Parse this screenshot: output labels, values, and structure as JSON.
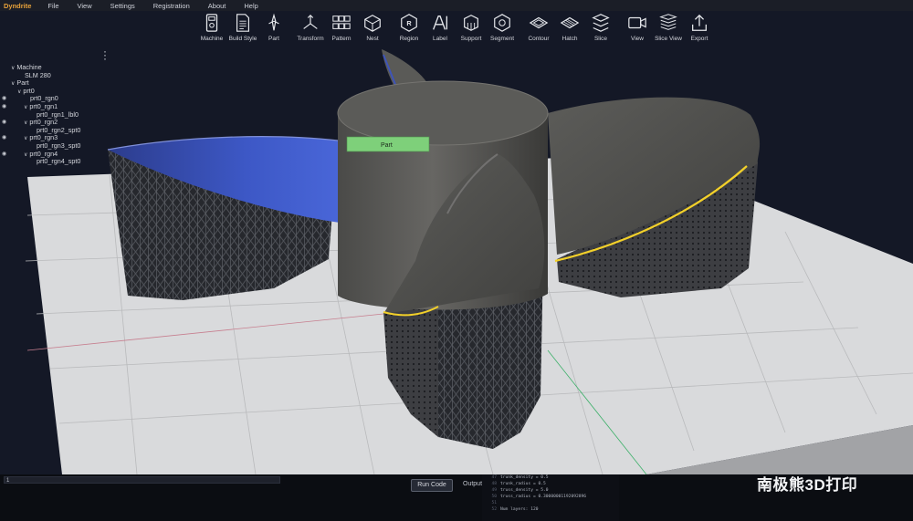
{
  "app": {
    "name": "Dyndrite"
  },
  "menu": [
    "File",
    "View",
    "Settings",
    "Registration",
    "About",
    "Help"
  ],
  "toolbar": [
    {
      "label": "Machine",
      "icon": "machine-icon"
    },
    {
      "label": "Build Style",
      "icon": "build-style-icon"
    },
    {
      "label": "Part",
      "icon": "part-icon"
    },
    {
      "label": "Transform",
      "icon": "transform-icon"
    },
    {
      "label": "Pattern",
      "icon": "pattern-icon"
    },
    {
      "label": "Nest",
      "icon": "nest-icon"
    },
    {
      "label": "Region",
      "icon": "region-icon"
    },
    {
      "label": "Label",
      "icon": "label-icon"
    },
    {
      "label": "Support",
      "icon": "support-icon"
    },
    {
      "label": "Segment",
      "icon": "segment-icon"
    },
    {
      "label": "Contour",
      "icon": "contour-icon"
    },
    {
      "label": "Hatch",
      "icon": "hatch-icon"
    },
    {
      "label": "Slice",
      "icon": "slice-icon"
    },
    {
      "label": "View",
      "icon": "camera-icon"
    },
    {
      "label": "Slice View",
      "icon": "slice-view-icon"
    },
    {
      "label": "Export",
      "icon": "export-icon"
    }
  ],
  "tree": [
    {
      "label": "Machine",
      "eye": false,
      "caret": true
    },
    {
      "label": "SLM 280",
      "eye": false,
      "caret": false
    },
    {
      "label": "Part",
      "eye": false,
      "caret": true
    },
    {
      "label": "prt0",
      "eye": false,
      "caret": true
    },
    {
      "label": "prt0_rgn0",
      "eye": true,
      "caret": false
    },
    {
      "label": "prt0_rgn1",
      "eye": true,
      "caret": true
    },
    {
      "label": "prt0_rgn1_lbl0",
      "eye": false,
      "caret": false
    },
    {
      "label": "prt0_rgn2",
      "eye": true,
      "caret": true
    },
    {
      "label": "prt0_rgn2_spt0",
      "eye": false,
      "caret": false
    },
    {
      "label": "prt0_rgn3",
      "eye": true,
      "caret": true
    },
    {
      "label": "prt0_rgn3_spt0",
      "eye": false,
      "caret": false
    },
    {
      "label": "prt0_rgn4",
      "eye": true,
      "caret": true
    },
    {
      "label": "prt0_rgn4_spt0",
      "eye": false,
      "caret": false
    }
  ],
  "viewport": {
    "part_label": "Part"
  },
  "console": {
    "prompt": "1"
  },
  "run_button": "Run Code",
  "output_label": "Output",
  "output_lines": [
    {
      "n": "47",
      "text": "trunk_density = 0.5"
    },
    {
      "n": "48",
      "text": "trunk_radius = 0.5"
    },
    {
      "n": "49",
      "text": "truss_density = 5.0"
    },
    {
      "n": "50",
      "text": "truss_radius = 0.30000001192092896"
    },
    {
      "n": "51",
      "text": ""
    },
    {
      "n": "52",
      "text": "Num layers:  120"
    }
  ],
  "watermark": "南极熊3D打印",
  "colors": {
    "accent": "#e8a23a",
    "highlight": "#f2d02a",
    "region": "#3f57c4",
    "label": "#7ed07a"
  }
}
